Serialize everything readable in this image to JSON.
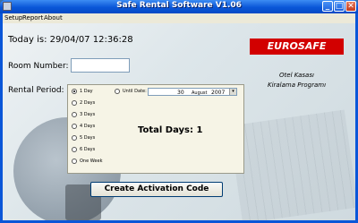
{
  "window": {
    "title": "Safe Rental Software V1.06",
    "minimize_glyph": "_",
    "maximize_glyph": "□",
    "close_glyph": "✕"
  },
  "menu": [
    "Setup",
    "Report",
    "About"
  ],
  "header": {
    "today_text": "Today is: 29/04/07 12:36:28"
  },
  "brand": {
    "name": "EUROSAFE",
    "subtitle_line1": "Otel Kasası",
    "subtitle_line2": "Kiralama Programı",
    "color": "#d20000"
  },
  "room": {
    "label": "Room Number:",
    "value": ""
  },
  "period": {
    "label": "Rental Period:",
    "options": [
      "1 Day",
      "2 Days",
      "3 Days",
      "4 Days",
      "5 Days",
      "6 Days",
      "One Week"
    ],
    "selected": "1 Day",
    "until_label": "Until Date:",
    "until_day": "30",
    "until_month": "August",
    "until_year": "2007",
    "dropdown_glyph": "▾",
    "total_days_text": "Total Days: 1"
  },
  "actions": {
    "create_label": "Create Activation Code"
  }
}
